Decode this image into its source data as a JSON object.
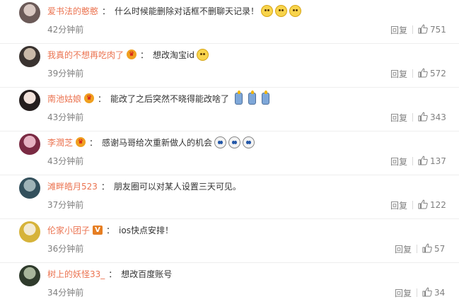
{
  "reply_label": "回复",
  "comments": [
    {
      "user": "爱书法的憨憨",
      "badge": "",
      "text": "什么时候能删除对话框不删聊天记录！",
      "emojis": [
        "worried",
        "worried",
        "worried"
      ],
      "time": "42分钟前",
      "likes": "751",
      "avatar_colors": [
        "#6b5a58",
        "#d9c8c2"
      ]
    },
    {
      "user": "我真的不想再吃肉了",
      "badge": "vip",
      "text": "想改淘宝id",
      "emojis": [
        "shy"
      ],
      "time": "39分钟前",
      "likes": "572",
      "avatar_colors": [
        "#3a3330",
        "#c9b9a8"
      ]
    },
    {
      "user": "南池姑娘",
      "badge": "vip",
      "text": "能改了之后突然不晓得能改啥了",
      "emojis": [
        "candle",
        "candle",
        "candle"
      ],
      "time": "43分钟前",
      "likes": "343",
      "avatar_colors": [
        "#241d1d",
        "#f1e1da"
      ]
    },
    {
      "user": "李潤芝",
      "badge": "vip",
      "text": "感谢马哥给次重新做人的机会",
      "emojis": [
        "cry",
        "cry",
        "cry"
      ],
      "time": "43分钟前",
      "likes": "137",
      "avatar_colors": [
        "#7a2a43",
        "#e6b2c2"
      ]
    },
    {
      "user": "滩畔皓月523",
      "badge": "",
      "text": "朋友圈可以对某人设置三天可见。",
      "emojis": [],
      "time": "37分钟前",
      "likes": "122",
      "avatar_colors": [
        "#33505c",
        "#9fb3b7"
      ]
    },
    {
      "user": "伦家小团子",
      "badge": "v",
      "text": "ios快点安排！",
      "emojis": [],
      "time": "36分钟前",
      "likes": "57",
      "avatar_colors": [
        "#d6b33a",
        "#f3ead2"
      ]
    },
    {
      "user": "树上的妖怪33_",
      "badge": "",
      "text": "想改百度账号",
      "emojis": [],
      "time": "34分钟前",
      "likes": "34",
      "avatar_colors": [
        "#2f3b2c",
        "#a8b59b"
      ]
    }
  ]
}
